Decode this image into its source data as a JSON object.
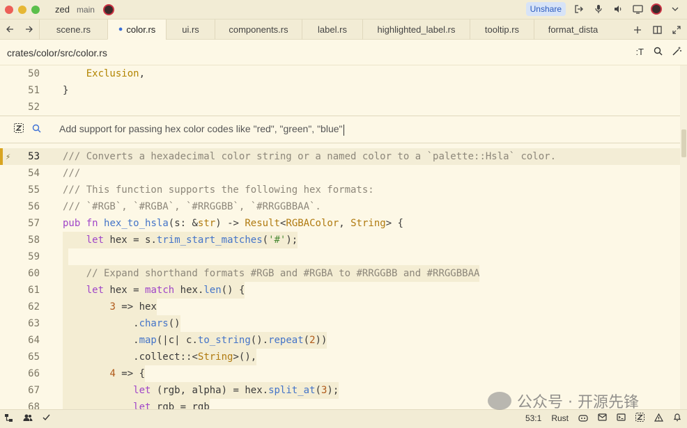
{
  "titlebar": {
    "project": "zed",
    "branch": "main",
    "unshare_label": "Unshare",
    "icons": [
      "leave-icon",
      "mic-icon",
      "speaker-icon",
      "screen-share-icon"
    ]
  },
  "tabbar": {
    "tabs": [
      {
        "label": "scene.rs",
        "active": false
      },
      {
        "label": "color.rs",
        "active": true
      },
      {
        "label": "ui.rs",
        "active": false
      },
      {
        "label": "components.rs",
        "active": false
      },
      {
        "label": "label.rs",
        "active": false
      },
      {
        "label": "highlighted_label.rs",
        "active": false
      },
      {
        "label": "tooltip.rs",
        "active": false
      },
      {
        "label": "format_dista",
        "active": false
      }
    ]
  },
  "breadcrumb": {
    "path": "crates/color/src/color.rs",
    "symbols_label": ":T"
  },
  "assistant": {
    "prompt": "Add support for passing hex color codes like \"red\", \"green\", \"blue\""
  },
  "editor": {
    "language": "Rust",
    "cursor": "53:1",
    "lines_before": [
      {
        "n": "50",
        "text": "    Exclusion,"
      },
      {
        "n": "51",
        "text": "}"
      },
      {
        "n": "52",
        "text": ""
      }
    ],
    "lines_after": [
      {
        "n": "53",
        "text": "/// Converts a hexadecimal color string or a named color to a `palette::Hsla` color."
      },
      {
        "n": "54",
        "text": "///"
      },
      {
        "n": "55",
        "text": "/// This function supports the following hex formats:"
      },
      {
        "n": "56",
        "text": "/// `#RGB`, `#RGBA`, `#RRGGBB`, `#RRGGBBAA`."
      },
      {
        "n": "57",
        "text": "pub fn hex_to_hsla(s: &str) -> Result<RGBAColor, String> {"
      },
      {
        "n": "58",
        "text": "    let hex = s.trim_start_matches('#');"
      },
      {
        "n": "59",
        "text": ""
      },
      {
        "n": "60",
        "text": "    // Expand shorthand formats #RGB and #RGBA to #RRGGBB and #RRGGBBAA"
      },
      {
        "n": "61",
        "text": "    let hex = match hex.len() {"
      },
      {
        "n": "62",
        "text": "        3 => hex"
      },
      {
        "n": "63",
        "text": "            .chars()"
      },
      {
        "n": "64",
        "text": "            .map(|c| c.to_string().repeat(2))"
      },
      {
        "n": "65",
        "text": "            .collect::<String>(),"
      },
      {
        "n": "66",
        "text": "        4 => {"
      },
      {
        "n": "67",
        "text": "            let (rgb, alpha) = hex.split_at(3);"
      },
      {
        "n": "68",
        "text": "            let rgb = rgb"
      }
    ]
  },
  "watermark": {
    "text": "公众号 · 开源先锋"
  },
  "colors": {
    "background": "#fdf8e6",
    "chrome": "#f2ecd5",
    "accent": "#3b6fd6",
    "keyword": "#a045c8",
    "function": "#4474c8",
    "type": "#b07a10",
    "comment": "#8d877a",
    "string": "#4a8a36",
    "number": "#b05a1a"
  }
}
